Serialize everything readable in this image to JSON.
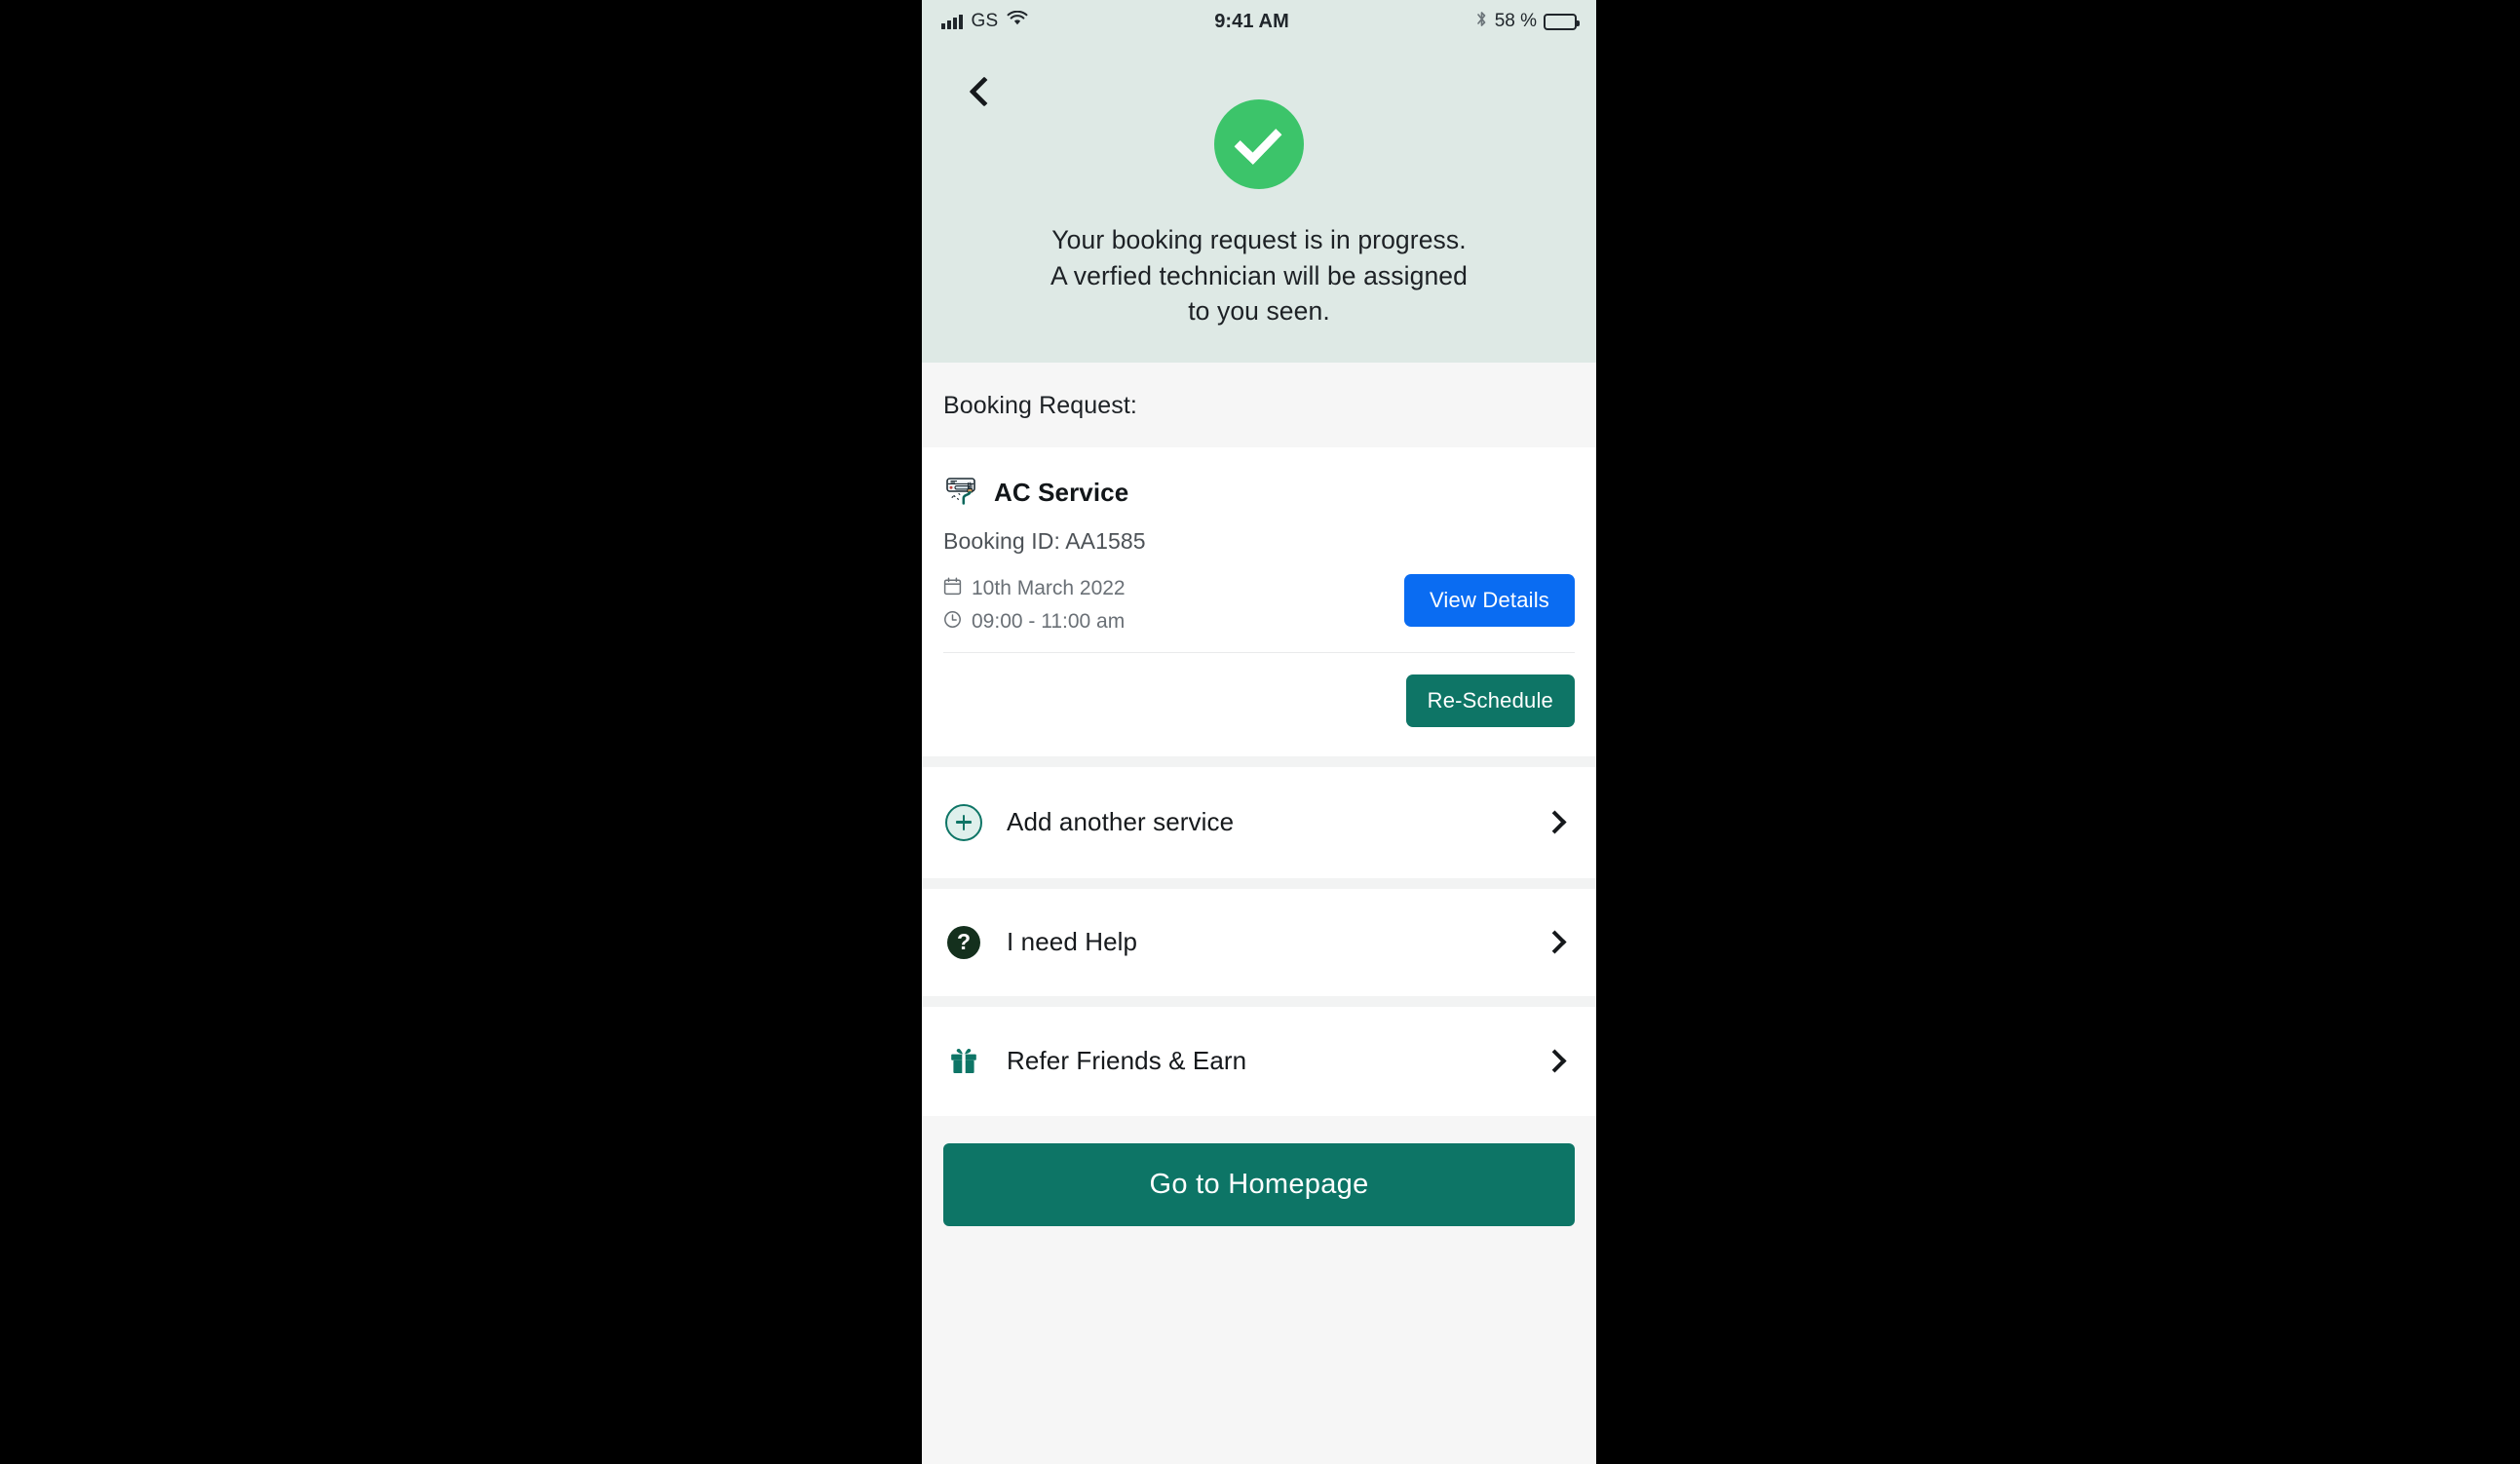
{
  "statusbar": {
    "carrier": "GS",
    "time": "9:41 AM",
    "battery_percent": "58 %",
    "signal_icon": "signal-bars-icon",
    "wifi_icon": "wifi-icon",
    "bluetooth_icon": "bluetooth-icon",
    "battery_icon": "battery-icon"
  },
  "hero": {
    "back_icon": "back-chevron-icon",
    "success_icon": "check-circle-icon",
    "message_line1": "Your booking request is in progress.",
    "message_line2": "A verfied technician will be assigned",
    "message_line3": "to you seen.",
    "background_color": "#dee9e5",
    "check_color": "#3cc46a"
  },
  "booking_section": {
    "title": "Booking Request:",
    "service_name": "AC Service",
    "service_icon": "air-conditioner-icon",
    "booking_id": "Booking ID: AA1585",
    "date": "10th March 2022",
    "time": "09:00 - 11:00 am",
    "calendar_icon": "calendar-icon",
    "clock_icon": "clock-icon",
    "view_details_label": "View Details",
    "reschedule_label": "Re-Schedule",
    "view_details_color": "#0a6cf2",
    "reschedule_color": "#0e7566"
  },
  "menu": {
    "items": [
      {
        "label": "Add another service",
        "icon": "plus-circle-icon",
        "chevron": "chevron-right-icon"
      },
      {
        "label": "I need Help",
        "icon": "question-mark-circle-icon",
        "chevron": "chevron-right-icon"
      },
      {
        "label": "Refer Friends & Earn",
        "icon": "gift-icon",
        "chevron": "chevron-right-icon"
      }
    ]
  },
  "footer": {
    "home_label": "Go to Homepage",
    "home_color": "#0d7566"
  }
}
